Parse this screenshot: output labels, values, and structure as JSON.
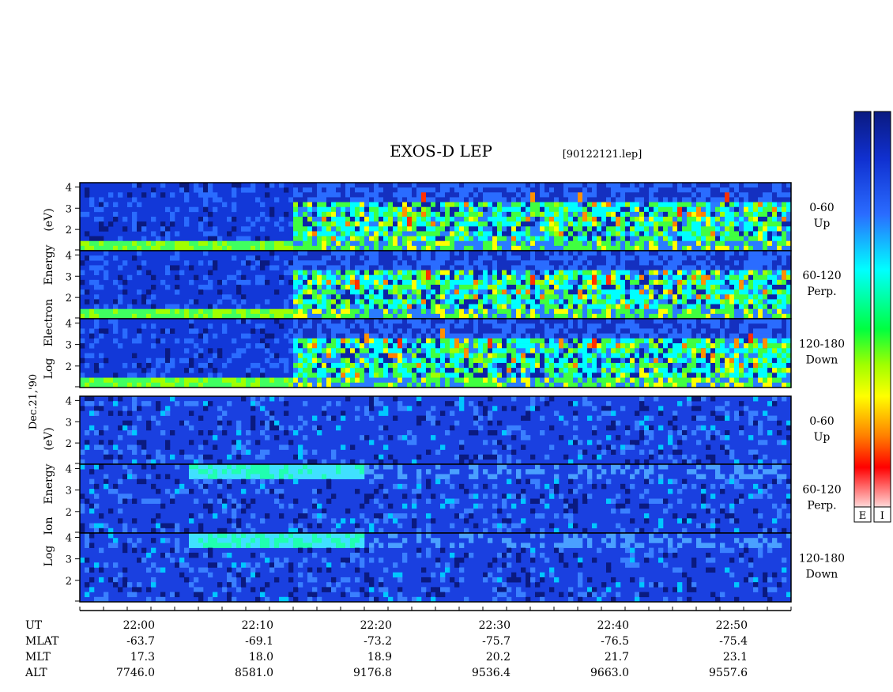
{
  "chart_data": {
    "type": "heatmap",
    "title": "EXOS-D LEP",
    "file_label": "[90122121.lep]",
    "date_label": "Dec.21,'90",
    "colorscale": [
      "#0a1a80",
      "#1030d0",
      "#2a6cff",
      "#00ffff",
      "#00ff40",
      "#a0ff00",
      "#ffff00",
      "#ff8000",
      "#ff0000",
      "#ffd8d8"
    ],
    "colorbar_labels": [
      "E",
      "I"
    ],
    "x_axis": {
      "ticks": [
        "22:00",
        "22:10",
        "22:20",
        "22:30",
        "22:40",
        "22:50"
      ],
      "start": "21:55",
      "end": "22:55"
    },
    "groups": [
      {
        "species": "Electron",
        "ylabel": [
          "Log",
          "Electron",
          "Energy",
          "(eV)"
        ],
        "yticks": [
          "4",
          "3",
          "2"
        ],
        "ylim": [
          1.0,
          4.2
        ],
        "panels": [
          {
            "angle": "0-60",
            "direction": "Up"
          },
          {
            "angle": "60-120",
            "direction": "Perp."
          },
          {
            "angle": "120-180",
            "direction": "Down"
          }
        ]
      },
      {
        "species": "Ion",
        "ylabel": [
          "Log",
          "Ion",
          "Energy",
          "(eV)"
        ],
        "yticks": [
          "4",
          "3",
          "2"
        ],
        "ylim": [
          1.0,
          4.2
        ],
        "panels": [
          {
            "angle": "0-60",
            "direction": "Up"
          },
          {
            "angle": "60-120",
            "direction": "Perp."
          },
          {
            "angle": "120-180",
            "direction": "Down"
          }
        ]
      }
    ],
    "ephemeris": {
      "labels": [
        "UT",
        "MLAT",
        "MLT",
        "ALT"
      ],
      "columns": [
        {
          "UT": "22:00",
          "MLAT": "-63.7",
          "MLT": "17.3",
          "ALT": "7746.0"
        },
        {
          "UT": "22:10",
          "MLAT": "-69.1",
          "MLT": "18.0",
          "ALT": "8581.0"
        },
        {
          "UT": "22:20",
          "MLAT": "-73.2",
          "MLT": "18.9",
          "ALT": "9176.8"
        },
        {
          "UT": "22:30",
          "MLAT": "-75.7",
          "MLT": "20.2",
          "ALT": "9536.4"
        },
        {
          "UT": "22:40",
          "MLAT": "-76.5",
          "MLT": "21.7",
          "ALT": "9663.0"
        },
        {
          "UT": "22:50",
          "MLAT": "-75.4",
          "MLT": "23.1",
          "ALT": "9557.6"
        }
      ]
    }
  }
}
